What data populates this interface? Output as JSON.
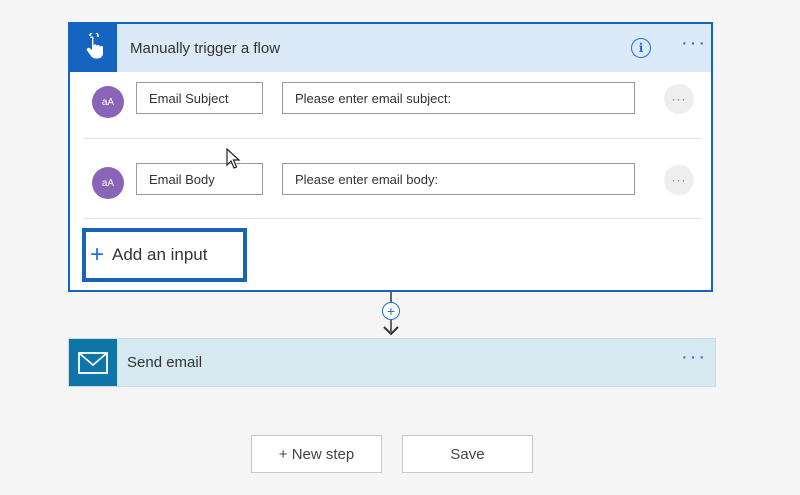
{
  "trigger": {
    "title": "Manually trigger a flow",
    "info_symbol": "i",
    "more_symbol": "···",
    "inputs": [
      {
        "avatar_text": "aA",
        "name": "Email Subject",
        "description": "Please enter email subject:",
        "more_symbol": "···"
      },
      {
        "avatar_text": "aA",
        "name": "Email Body",
        "description": "Please enter email body:",
        "more_symbol": "···"
      }
    ],
    "add_input": {
      "icon": "plus-icon",
      "label": "Add an input"
    }
  },
  "connector": {
    "add_symbol": "+"
  },
  "action": {
    "title": "Send email",
    "icon": "mail-icon",
    "more_symbol": "···"
  },
  "footer": {
    "new_step_label": "+ New step",
    "save_label": "Save"
  },
  "colors": {
    "trigger_accent": "#1565c0",
    "trigger_header_bg": "#dce9f8",
    "action_accent": "#0f75a8",
    "action_bg": "#d6e9f0",
    "avatar": "#8a64b8",
    "highlight_box": "#1a63b4"
  }
}
